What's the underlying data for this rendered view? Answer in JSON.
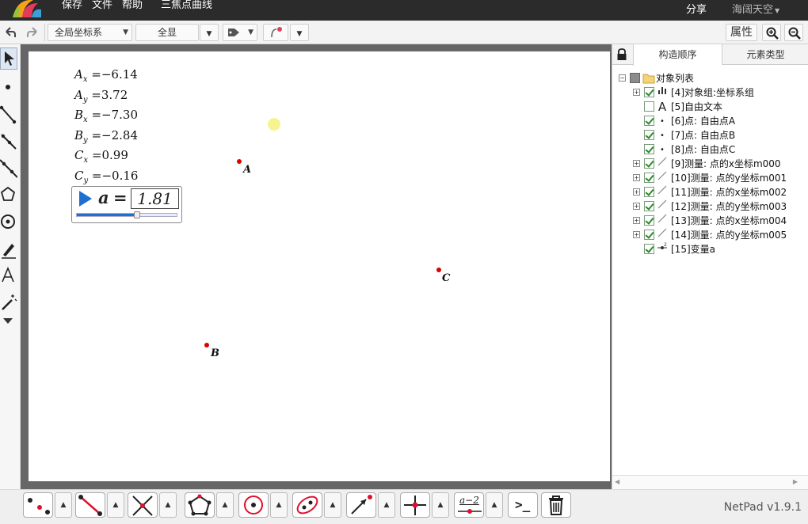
{
  "topbar": {
    "menu": [
      "保存",
      "文件",
      "帮助"
    ],
    "doc_title": "三焦点曲线",
    "share": "分享",
    "user": "海阔天空"
  },
  "toolbar": {
    "coord_system": "全局坐标系",
    "view_all": "全显",
    "properties": "属性"
  },
  "canvas": {
    "measurements": [
      {
        "var": "A",
        "sub": "x",
        "value": "−6.14"
      },
      {
        "var": "A",
        "sub": "y",
        "value": "3.72"
      },
      {
        "var": "B",
        "sub": "x",
        "value": "−7.30"
      },
      {
        "var": "B",
        "sub": "y",
        "value": "−2.84"
      },
      {
        "var": "C",
        "sub": "x",
        "value": "0.99"
      },
      {
        "var": "C",
        "sub": "y",
        "value": "−0.16"
      }
    ],
    "slider": {
      "name": "a",
      "equals": "=",
      "value": "1.81",
      "fill_fraction": 0.6
    },
    "points": [
      {
        "label": "A",
        "color": "#d00000"
      },
      {
        "label": "B",
        "color": "#d00000"
      },
      {
        "label": "C",
        "color": "#d00000"
      }
    ]
  },
  "panel": {
    "tabs": [
      "构造顺序",
      "元素类型"
    ],
    "root": "对象列表",
    "items": [
      {
        "text": "[4]对象组:坐标系组",
        "icon": "chart-icon",
        "checked": true,
        "expandable": true
      },
      {
        "text": "[5]自由文本",
        "icon": "text-icon",
        "checked": false,
        "expandable": false
      },
      {
        "text": "[6]点: 自由点A",
        "icon": "point-icon",
        "checked": true,
        "expandable": false
      },
      {
        "text": "[7]点: 自由点B",
        "icon": "point-icon",
        "checked": true,
        "expandable": false
      },
      {
        "text": "[8]点: 自由点C",
        "icon": "point-icon",
        "checked": true,
        "expandable": false
      },
      {
        "text": "[9]测量: 点的x坐标m000",
        "icon": "measure-icon",
        "checked": true,
        "expandable": true
      },
      {
        "text": "[10]测量: 点的y坐标m001",
        "icon": "measure-icon",
        "checked": true,
        "expandable": true
      },
      {
        "text": "[11]测量: 点的x坐标m002",
        "icon": "measure-icon",
        "checked": true,
        "expandable": true
      },
      {
        "text": "[12]测量: 点的y坐标m003",
        "icon": "measure-icon",
        "checked": true,
        "expandable": true
      },
      {
        "text": "[13]测量: 点的x坐标m004",
        "icon": "measure-icon",
        "checked": true,
        "expandable": true
      },
      {
        "text": "[14]测量: 点的y坐标m005",
        "icon": "measure-icon",
        "checked": true,
        "expandable": true
      },
      {
        "text": "[15]变量a",
        "icon": "variable-icon",
        "checked": true,
        "expandable": false
      }
    ]
  },
  "bottom": {
    "calc_label": "a−2",
    "prompt_label": ">_",
    "version": "NetPad v1.9.1"
  }
}
